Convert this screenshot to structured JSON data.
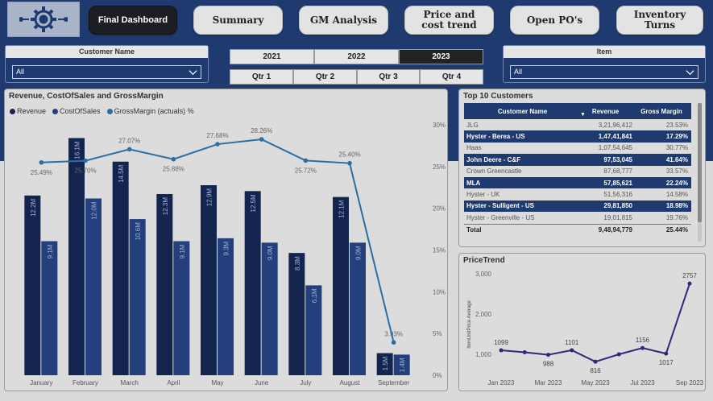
{
  "nav": {
    "buttons": [
      "Final Dashboard",
      "Summary",
      "GM Analysis",
      "Price and cost trend",
      "Open PO's",
      "Inventory Turns"
    ],
    "active": "Final Dashboard"
  },
  "filters": {
    "customer": {
      "title": "Customer Name",
      "value": "All"
    },
    "item": {
      "title": "Item",
      "value": "All"
    },
    "years": [
      "2021",
      "2022",
      "2023"
    ],
    "selected_year": "2023",
    "quarters": [
      "Qtr 1",
      "Qtr 2",
      "Qtr 3",
      "Qtr 4"
    ]
  },
  "colors": {
    "revenue": "#13254f",
    "cost": "#233f7c",
    "gm_line": "#2b6ea3",
    "header": "#1f3a6e"
  },
  "top_customers": {
    "title": "Top 10 Customers",
    "columns": [
      "Customer Name",
      "Revenue",
      "Gross Margin"
    ],
    "rows": [
      {
        "name": "JLG",
        "revenue": "3,21,96,412",
        "gm": "23.53%",
        "highlight": false
      },
      {
        "name": "Hyster - Berea - US",
        "revenue": "1,47,41,841",
        "gm": "17.29%",
        "highlight": true
      },
      {
        "name": "Haas",
        "revenue": "1,07,54,645",
        "gm": "30.77%",
        "highlight": false
      },
      {
        "name": "John Deere - C&F",
        "revenue": "97,53,045",
        "gm": "41.64%",
        "highlight": true
      },
      {
        "name": "Crown Greencastle",
        "revenue": "87,68,777",
        "gm": "33.57%",
        "highlight": false
      },
      {
        "name": "MLA",
        "revenue": "57,85,621",
        "gm": "22.24%",
        "highlight": true
      },
      {
        "name": "Hyster - UK",
        "revenue": "51,56,316",
        "gm": "14.58%",
        "highlight": false
      },
      {
        "name": "Hyster - Sulligent - US",
        "revenue": "29,81,850",
        "gm": "18.98%",
        "highlight": true
      },
      {
        "name": "Hyster - Greenville - US",
        "revenue": "19,01,815",
        "gm": "19.76%",
        "highlight": false
      }
    ],
    "total": {
      "name": "Total",
      "revenue": "9,48,94,779",
      "gm": "25.44%"
    }
  },
  "chart_data": [
    {
      "type": "bar",
      "title": "Revenue, CostOfSales and GrossMargin",
      "categories": [
        "January",
        "February",
        "March",
        "April",
        "May",
        "June",
        "July",
        "August",
        "September"
      ],
      "series": [
        {
          "name": "Revenue",
          "values": [
            12.2,
            16.1,
            14.5,
            12.3,
            12.9,
            12.5,
            8.3,
            12.1,
            1.5
          ],
          "labels": [
            "12.2M",
            "16.1M",
            "14.5M",
            "12.3M",
            "12.9M",
            "12.5M",
            "8.3M",
            "12.1M",
            "1.5M"
          ]
        },
        {
          "name": "CostOfSales",
          "values": [
            9.1,
            12.0,
            10.6,
            9.1,
            9.3,
            9.0,
            6.1,
            9.0,
            1.4
          ],
          "labels": [
            "9.1M",
            "12.0M",
            "10.6M",
            "9.1M",
            "9.3M",
            "9.0M",
            "6.1M",
            "9.0M",
            "1.4M"
          ]
        }
      ],
      "line": {
        "name": "GrossMargin (actuals) %",
        "values": [
          25.49,
          25.7,
          27.07,
          25.88,
          27.68,
          28.26,
          25.72,
          25.4,
          3.93
        ],
        "labels": [
          "25.49%",
          "25.70%",
          "27.07%",
          "25.88%",
          "27.68%",
          "28.26%",
          "25.72%",
          "25.40%",
          "3.93%"
        ]
      },
      "y2_ticks": [
        "0%",
        "5%",
        "10%",
        "15%",
        "20%",
        "25%",
        "30%"
      ],
      "y2lim": [
        0,
        30
      ],
      "ylim": [
        0,
        17
      ]
    },
    {
      "type": "line",
      "title": "PriceTrend",
      "ylabel": "ItemUnitPrice Average",
      "y_ticks": [
        "1,000",
        "2,000",
        "3,000"
      ],
      "ylim": [
        600,
        3100
      ],
      "x_ticks": [
        "Jan 2023",
        "Mar 2023",
        "May 2023",
        "Jul 2023",
        "Sep 2023"
      ],
      "values": [
        1099,
        1050,
        988,
        1101,
        816,
        1000,
        1156,
        1017,
        2757
      ],
      "point_labels": [
        "1099",
        "",
        "988",
        "1101",
        "816",
        "",
        "1156",
        "1017",
        "2757"
      ],
      "legend": "none",
      "grid": false
    }
  ]
}
